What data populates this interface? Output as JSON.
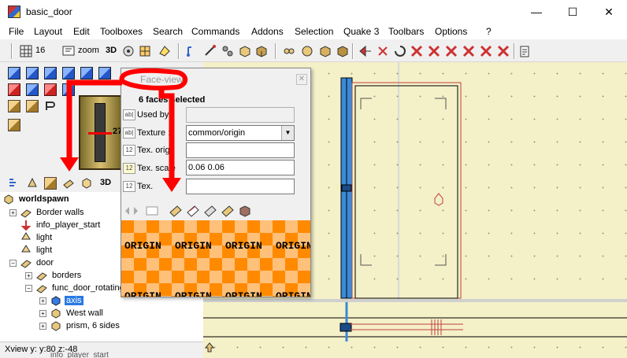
{
  "window": {
    "title": "basic_door",
    "minimize": "—",
    "maximize": "☐",
    "close": "✕"
  },
  "menu": [
    "File",
    "Layout",
    "Edit",
    "Toolboxes",
    "Search",
    "Commands",
    "Addons",
    "Selection",
    "Quake 3",
    "Toolbars",
    "Options",
    "?"
  ],
  "toolbar": {
    "grid_value": "16",
    "zoom_label": "zoom",
    "view3d_label": "3D"
  },
  "left_panel": {
    "preview_number": "27",
    "tools_3d_label": "3D"
  },
  "tree": {
    "root": "worldspawn",
    "items": [
      {
        "label": "Border walls"
      },
      {
        "label": "info_player_start"
      },
      {
        "label": "light"
      },
      {
        "label": "light"
      },
      {
        "label": "door"
      },
      {
        "label": "borders"
      },
      {
        "label": "func_door_rotating"
      },
      {
        "label": "axis",
        "selected": true
      },
      {
        "label": "West wall"
      },
      {
        "label": "prism, 6 sides"
      }
    ],
    "partial_bottom": "info_player_start"
  },
  "status": {
    "text": "Xview y: y:80 z:-48"
  },
  "face_view": {
    "title": "Face-view",
    "heading": "6 faces selected",
    "rows": [
      {
        "icon": "ab|",
        "label": "Used by :",
        "value": ""
      },
      {
        "icon": "ab|",
        "label": "Texture :",
        "value": "common/origin"
      },
      {
        "icon": "12",
        "label": "Tex. origi",
        "value": ""
      },
      {
        "icon": "12",
        "label": "Tex. scale",
        "value": "0.06 0.06"
      },
      {
        "icon": "12",
        "label": "Tex. ",
        "value": ""
      }
    ],
    "texture_word": "ORIGIN"
  },
  "colors": {
    "annotation": "#ff0000",
    "selection": "#2a7ae2",
    "map_background": "#f4f0c8",
    "brush_blue": "#3a8ad8",
    "texture_orange": "#ff8a00"
  }
}
